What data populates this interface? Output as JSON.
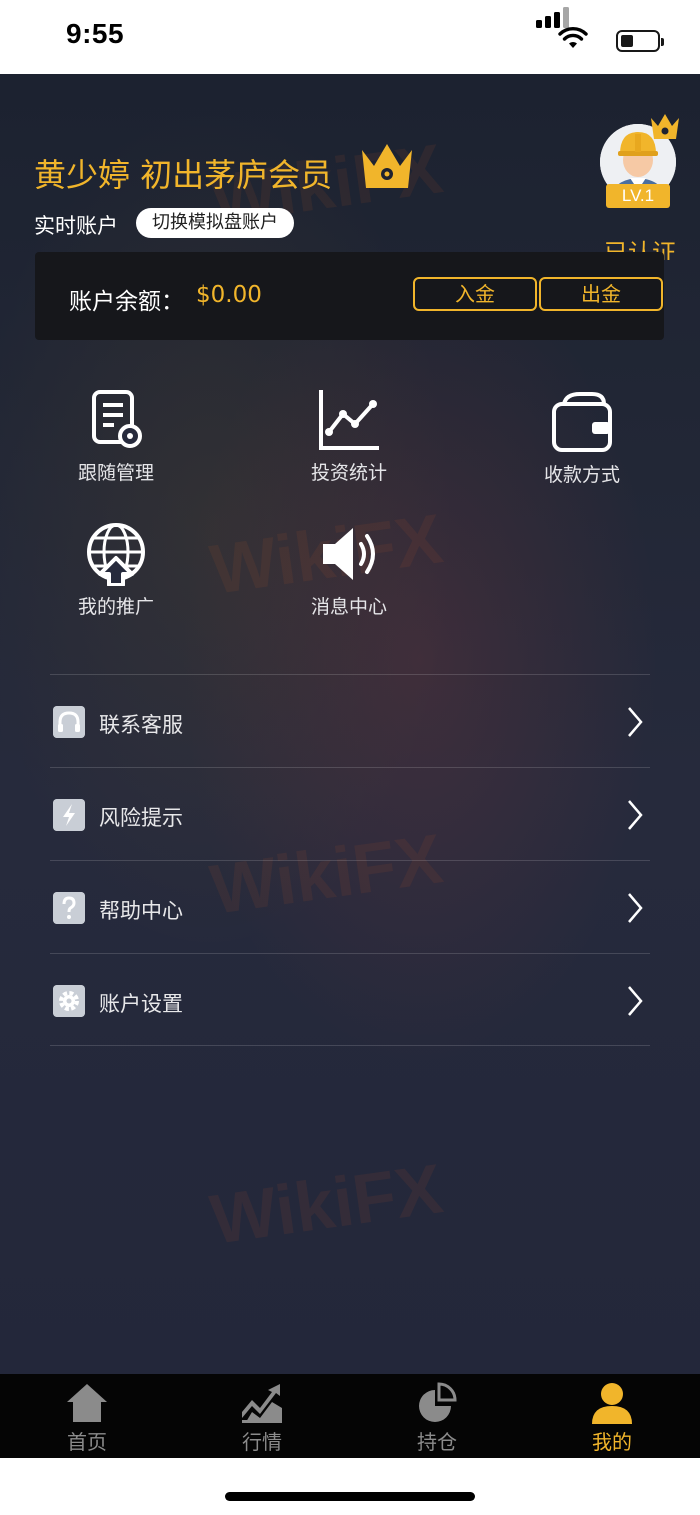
{
  "status_bar": {
    "time": "9:55"
  },
  "user": {
    "name": "黄少婷 初出茅庐会员",
    "account_type": "实时账户",
    "switch_label": "切换模拟盘账户",
    "level": "LV.1",
    "partial_text": "已认证"
  },
  "balance": {
    "label": "账户余额：",
    "value": "$0.00",
    "deposit_label": "入金",
    "withdraw_label": "出金"
  },
  "grid": [
    {
      "label": "跟随管理",
      "icon": "document-gear-icon"
    },
    {
      "label": "投资统计",
      "icon": "line-chart-icon"
    },
    {
      "label": "收款方式",
      "icon": "wallet-icon"
    },
    {
      "label": "我的推广",
      "icon": "globe-upload-icon"
    },
    {
      "label": "消息中心",
      "icon": "speaker-icon"
    }
  ],
  "menu": [
    {
      "label": "联系客服",
      "icon": "headset-icon"
    },
    {
      "label": "风险提示",
      "icon": "lightning-icon"
    },
    {
      "label": "帮助中心",
      "icon": "question-icon"
    },
    {
      "label": "账户设置",
      "icon": "gear-icon"
    }
  ],
  "tabs": [
    {
      "label": "首页",
      "icon": "home-icon"
    },
    {
      "label": "行情",
      "icon": "chart-icon"
    },
    {
      "label": "持仓",
      "icon": "pie-icon"
    },
    {
      "label": "我的",
      "icon": "user-icon",
      "active": true
    }
  ],
  "colors": {
    "accent": "#f1b52b",
    "card": "#16171b",
    "tab_bar": "#050505"
  }
}
